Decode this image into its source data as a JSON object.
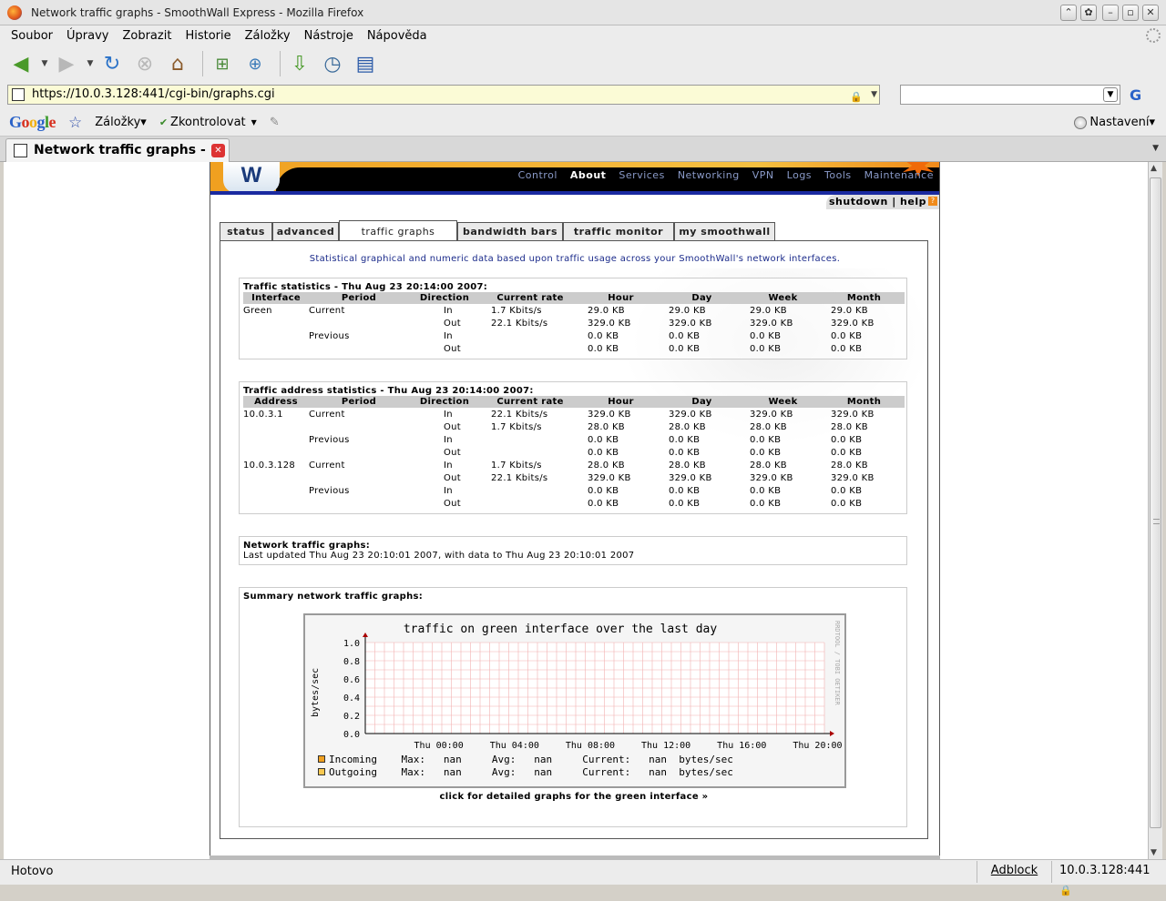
{
  "window": {
    "title": "Network traffic graphs - SmoothWall Express - Mozilla Firefox"
  },
  "menu": [
    "Soubor",
    "Úpravy",
    "Zobrazit",
    "Historie",
    "Záložky",
    "Nástroje",
    "Nápověda"
  ],
  "url": "https://10.0.3.128:441/cgi-bin/graphs.cgi",
  "gtoolbar": {
    "logo": "Google",
    "bookmarks": "Záložky▾",
    "spell": "Zkontrolovat",
    "settings": "Nastavení▾"
  },
  "tab": {
    "title": "Network traffic graphs - ..."
  },
  "status": {
    "text": "Hotovo",
    "adblock": "Adblock",
    "host": "10.0.3.128:441"
  },
  "sw": {
    "nav": [
      "Control",
      "About",
      "Services",
      "Networking",
      "VPN",
      "Logs",
      "Tools",
      "Maintenance"
    ],
    "active_nav": "About",
    "sublinks": "shutdown | help",
    "tabs": [
      {
        "label": "status",
        "active": false
      },
      {
        "label": "advanced",
        "active": false
      },
      {
        "label": "traffic graphs",
        "active": true
      },
      {
        "label": "bandwidth bars",
        "active": false
      },
      {
        "label": "traffic monitor",
        "active": false
      },
      {
        "label": "my smoothwall",
        "active": false
      }
    ],
    "intro": "Statistical graphical and numeric data based upon traffic usage across your SmoothWall's network interfaces.",
    "traffic_stats": {
      "title": "Traffic statistics - Thu Aug 23 20:14:00 2007:",
      "headers": [
        "Interface",
        "Period",
        "Direction",
        "Current rate",
        "Hour",
        "Day",
        "Week",
        "Month"
      ],
      "rows": [
        [
          "Green",
          "Current",
          "In",
          "1.7 Kbits/s",
          "29.0 KB",
          "29.0 KB",
          "29.0 KB",
          "29.0 KB"
        ],
        [
          "",
          "",
          "Out",
          "22.1 Kbits/s",
          "329.0 KB",
          "329.0 KB",
          "329.0 KB",
          "329.0 KB"
        ],
        [
          "",
          "Previous",
          "In",
          "",
          "0.0 KB",
          "0.0 KB",
          "0.0 KB",
          "0.0 KB"
        ],
        [
          "",
          "",
          "Out",
          "",
          "0.0 KB",
          "0.0 KB",
          "0.0 KB",
          "0.0 KB"
        ]
      ]
    },
    "address_stats": {
      "title": "Traffic address statistics - Thu Aug 23 20:14:00 2007:",
      "headers": [
        "Address",
        "Period",
        "Direction",
        "Current rate",
        "Hour",
        "Day",
        "Week",
        "Month"
      ],
      "rows": [
        [
          "10.0.3.1",
          "Current",
          "In",
          "22.1 Kbits/s",
          "329.0 KB",
          "329.0 KB",
          "329.0 KB",
          "329.0 KB"
        ],
        [
          "",
          "",
          "Out",
          "1.7 Kbits/s",
          "28.0 KB",
          "28.0 KB",
          "28.0 KB",
          "28.0 KB"
        ],
        [
          "",
          "Previous",
          "In",
          "",
          "0.0 KB",
          "0.0 KB",
          "0.0 KB",
          "0.0 KB"
        ],
        [
          "",
          "",
          "Out",
          "",
          "0.0 KB",
          "0.0 KB",
          "0.0 KB",
          "0.0 KB"
        ],
        [
          "10.0.3.128",
          "Current",
          "In",
          "1.7 Kbits/s",
          "28.0 KB",
          "28.0 KB",
          "28.0 KB",
          "28.0 KB"
        ],
        [
          "",
          "",
          "Out",
          "22.1 Kbits/s",
          "329.0 KB",
          "329.0 KB",
          "329.0 KB",
          "329.0 KB"
        ],
        [
          "",
          "Previous",
          "In",
          "",
          "0.0 KB",
          "0.0 KB",
          "0.0 KB",
          "0.0 KB"
        ],
        [
          "",
          "",
          "Out",
          "",
          "0.0 KB",
          "0.0 KB",
          "0.0 KB",
          "0.0 KB"
        ]
      ]
    },
    "graphs_info": {
      "title": "Network traffic graphs:",
      "updated": "Last updated Thu Aug 23 20:10:01 2007, with data to Thu Aug 23 20:10:01 2007"
    },
    "summary_title": "Summary network traffic graphs:",
    "detail_link": "click for detailed graphs for the green interface »"
  },
  "chart_data": {
    "type": "area",
    "title": "traffic on green interface over the last day",
    "ylabel": "bytes/sec",
    "xlabel": "",
    "ylim": [
      0,
      1.0
    ],
    "yticks": [
      "0.0",
      "0.2",
      "0.4",
      "0.6",
      "0.8",
      "1.0"
    ],
    "xticks": [
      "Thu 00:00",
      "Thu 04:00",
      "Thu 08:00",
      "Thu 12:00",
      "Thu 16:00",
      "Thu 20:00"
    ],
    "grid": true,
    "watermark": "RRDTOOL / TOBI OETIKER",
    "series": [
      {
        "name": "Incoming",
        "color": "#f0a020",
        "values": [],
        "max": "nan",
        "avg": "nan",
        "current": "nan",
        "unit": "bytes/sec"
      },
      {
        "name": "Outgoing",
        "color": "#f8c850",
        "values": [],
        "max": "nan",
        "avg": "nan",
        "current": "nan",
        "unit": "bytes/sec"
      }
    ],
    "legend_labels": {
      "max": "Max:",
      "avg": "Avg:",
      "current": "Current:"
    }
  }
}
